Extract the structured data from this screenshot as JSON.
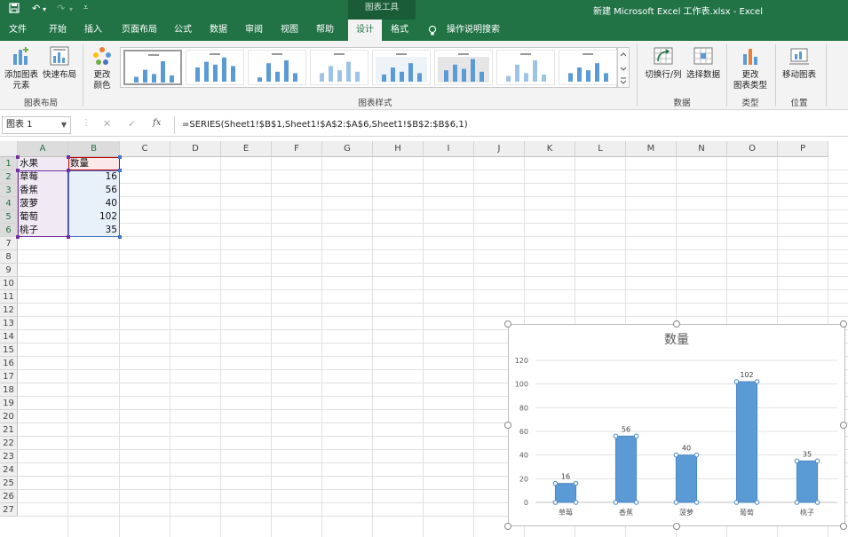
{
  "titlebar": {
    "context_tab": "图表工具",
    "doc_title": "新建 Microsoft Excel 工作表.xlsx  -  Excel"
  },
  "tabs": [
    "文件",
    "开始",
    "插入",
    "页面布局",
    "公式",
    "数据",
    "审阅",
    "视图",
    "帮助",
    "设计",
    "格式",
    "操作说明搜索"
  ],
  "ribbon": {
    "add_element": [
      "添加图表",
      "元素"
    ],
    "quick_layout": "快速布局",
    "change_color": [
      "更改",
      "颜色"
    ],
    "group_layout": "图表布局",
    "group_styles": "图表样式",
    "switch_rowcol": "切换行/列",
    "select_data": "选择数据",
    "group_data": "数据",
    "change_type": [
      "更改",
      "图表类型"
    ],
    "group_type": "类型",
    "move_chart": "移动图表",
    "group_location": "位置"
  },
  "formula_bar": {
    "name_box": "图表 1",
    "cancel": "✕",
    "enter": "✓",
    "fx": "fx",
    "formula": "=SERIES(Sheet1!$B$1,Sheet1!$A$2:$A$6,Sheet1!$B$2:$B$6,1)"
  },
  "sheet": {
    "columns": [
      "A",
      "B",
      "C",
      "D",
      "E",
      "F",
      "G",
      "H",
      "I",
      "J",
      "K",
      "L",
      "M",
      "N",
      "O",
      "P"
    ],
    "rows": [
      "1",
      "2",
      "3",
      "4",
      "5",
      "6",
      "7",
      "8",
      "9",
      "10",
      "11",
      "12",
      "13",
      "14",
      "15",
      "16",
      "17",
      "18",
      "19",
      "20",
      "21",
      "22",
      "23",
      "24",
      "25",
      "26",
      "27"
    ],
    "header": [
      "水果",
      "数量"
    ],
    "data": [
      [
        "草莓",
        "16"
      ],
      [
        "香蕉",
        "56"
      ],
      [
        "菠萝",
        "40"
      ],
      [
        "葡萄",
        "102"
      ],
      [
        "桃子",
        "35"
      ]
    ]
  },
  "chart_data": {
    "type": "bar",
    "title": "数量",
    "categories": [
      "草莓",
      "香蕉",
      "菠萝",
      "葡萄",
      "桃子"
    ],
    "values": [
      16,
      56,
      40,
      102,
      35
    ],
    "ylim": [
      0,
      120
    ],
    "yticks": [
      0,
      20,
      40,
      60,
      80,
      100,
      120
    ],
    "grid": true,
    "bar_color": "#5b9bd5"
  },
  "colors": {
    "excel_green": "#217346",
    "selection_purple": "#7030a0",
    "selection_blue": "#4472c4"
  }
}
